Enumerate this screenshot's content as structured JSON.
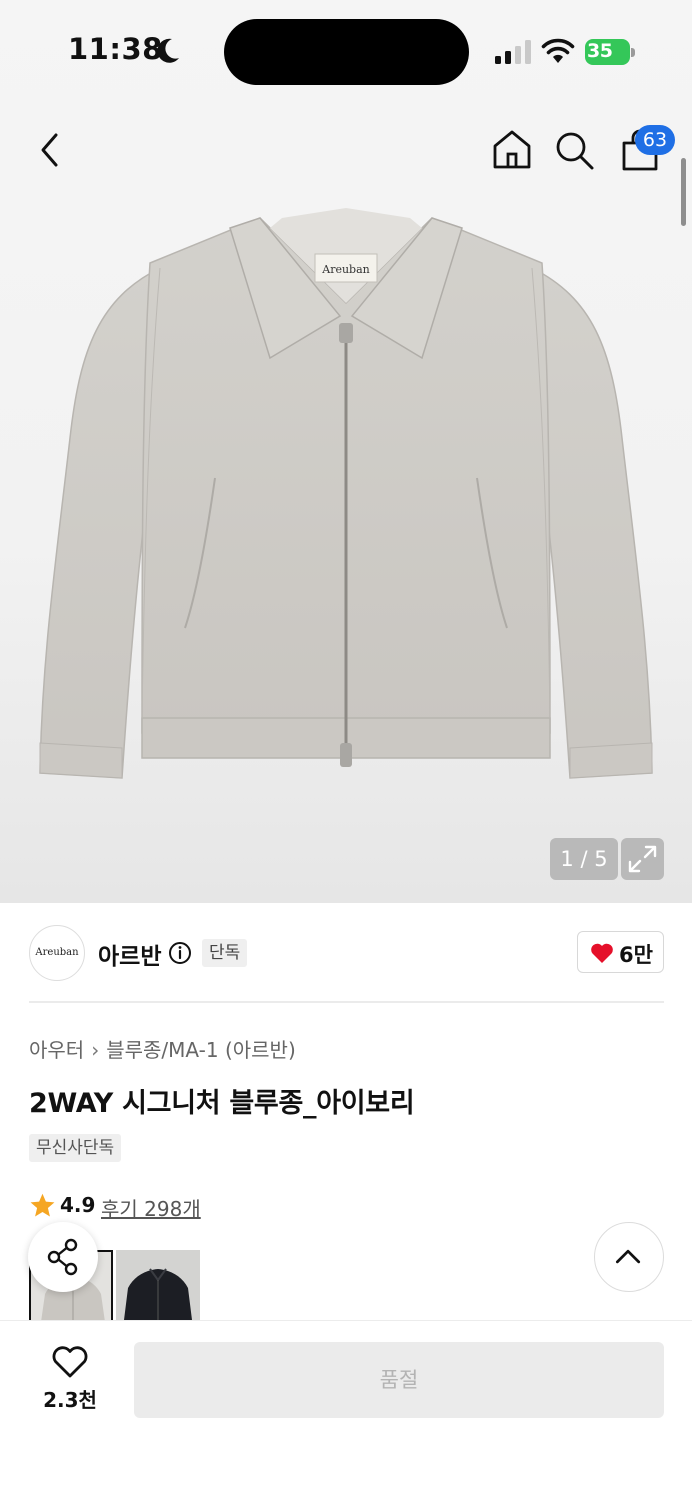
{
  "status_bar": {
    "time": "11:38",
    "battery_percent": "35",
    "icons": [
      "moon-icon",
      "signal-icon",
      "wifi-icon",
      "battery-icon"
    ]
  },
  "nav": {
    "icons": [
      "back-arrow-icon",
      "home-icon",
      "search-icon",
      "shopping-bag-icon"
    ],
    "cart_count": "63"
  },
  "gallery": {
    "counter": "1 / 5",
    "label_text": "Areuban"
  },
  "brand": {
    "logo_text": "Areuban",
    "name": "아르반",
    "tag": "단독",
    "like_count": "6만"
  },
  "product": {
    "breadcrumb": [
      "아우터",
      "블루종/MA-1 (아르반)"
    ],
    "title": "2WAY 시그니처 블루종_아이보리",
    "tag": "무신사단독",
    "rating": "4.9",
    "review_label": "후기 298개"
  },
  "colors": {
    "accent_blue": "#1f6fe5",
    "heart_red": "#e5102a",
    "star_orange": "#f5a623",
    "jacket": "#cfcdc8"
  },
  "bottom_bar": {
    "wishlist_count": "2.3천",
    "buy_button_label": "품절"
  }
}
